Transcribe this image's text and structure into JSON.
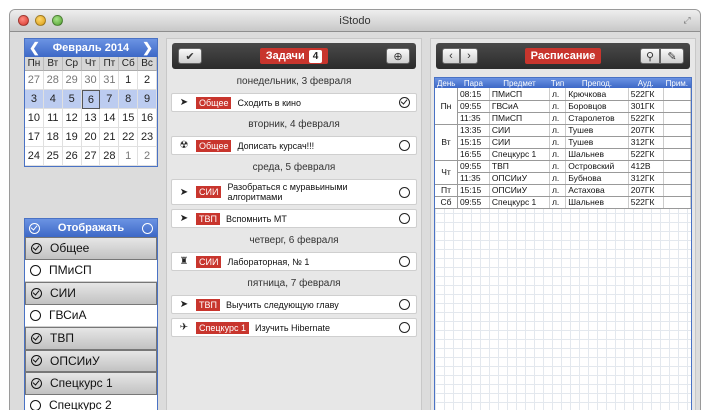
{
  "window": {
    "title": "iStodo"
  },
  "calendar": {
    "month": "Февраль 2014",
    "weekdays": [
      "Пн",
      "Вт",
      "Ср",
      "Чт",
      "Пт",
      "Сб",
      "Вс"
    ],
    "weeks": [
      [
        "27",
        "28",
        "29",
        "30",
        "31",
        "1",
        "2"
      ],
      [
        "3",
        "4",
        "5",
        "6",
        "7",
        "8",
        "9"
      ],
      [
        "10",
        "11",
        "12",
        "13",
        "14",
        "15",
        "16"
      ],
      [
        "17",
        "18",
        "19",
        "20",
        "21",
        "22",
        "23"
      ],
      [
        "24",
        "25",
        "26",
        "27",
        "28",
        "1",
        "2"
      ]
    ]
  },
  "filter": {
    "title": "Отображать",
    "items": [
      {
        "label": "Общее",
        "on": true
      },
      {
        "label": "ПМиСП",
        "on": false
      },
      {
        "label": "СИИ",
        "on": true
      },
      {
        "label": "ГВСиА",
        "on": false
      },
      {
        "label": "ТВП",
        "on": true
      },
      {
        "label": "ОПСИиУ",
        "on": true
      },
      {
        "label": "Спецкурс 1",
        "on": true
      },
      {
        "label": "Спецкурс 2",
        "on": false
      }
    ]
  },
  "tasks": {
    "title": "Задачи",
    "count": "4",
    "days": [
      {
        "date": "понедельник, 3 февраля",
        "items": [
          {
            "icon": "cursor-icon",
            "glyph": "➤",
            "tag": "Общее",
            "text": "Сходить в кино",
            "done": true
          }
        ]
      },
      {
        "date": "вторник, 4 февраля",
        "items": [
          {
            "icon": "radiation-icon",
            "glyph": "☢",
            "tag": "Общее",
            "text": "Дописать курсач!!!",
            "done": false
          }
        ]
      },
      {
        "date": "среда, 5 февраля",
        "items": [
          {
            "icon": "cursor-icon",
            "glyph": "➤",
            "tag": "СИИ",
            "text": "Разобраться с муравьиными алгоритмами",
            "done": false
          },
          {
            "icon": "cursor-icon",
            "glyph": "➤",
            "tag": "ТВП",
            "text": "Вспомнить МТ",
            "done": false
          }
        ]
      },
      {
        "date": "четверг, 6 февраля",
        "items": [
          {
            "icon": "lab-icon",
            "glyph": "♜",
            "tag": "СИИ",
            "text": "Лабораторная, № 1",
            "done": false
          }
        ]
      },
      {
        "date": "пятница, 7 февраля",
        "items": [
          {
            "icon": "cursor-icon",
            "glyph": "➤",
            "tag": "ТВП",
            "text": "Выучить следующую главу",
            "done": false
          },
          {
            "icon": "plane-icon",
            "glyph": "✈",
            "tag": "Спецкурс 1",
            "text": "Изучить Hibernate",
            "done": false
          }
        ]
      }
    ]
  },
  "schedule": {
    "title": "Расписание",
    "columns": [
      "День",
      "Пара",
      "Предмет",
      "Тип",
      "Препод.",
      "Ауд.",
      "Прим."
    ],
    "days": [
      {
        "day": "Пн",
        "rows": [
          [
            "08:15",
            "ПМиСП",
            "л.",
            "Крючкова",
            "522ГК",
            ""
          ],
          [
            "09:55",
            "ГВСиА",
            "л.",
            "Боровцов",
            "301ГК",
            ""
          ],
          [
            "11:35",
            "ПМиСП",
            "л.",
            "Старолетов",
            "522ГК",
            ""
          ]
        ]
      },
      {
        "day": "Вт",
        "rows": [
          [
            "13:35",
            "СИИ",
            "л.",
            "Тушев",
            "207ГК",
            ""
          ],
          [
            "15:15",
            "СИИ",
            "л.",
            "Тушев",
            "312ГК",
            ""
          ],
          [
            "16:55",
            "Спецкурс 1",
            "л.",
            "Шальнев",
            "522ГК",
            ""
          ]
        ]
      },
      {
        "day": "Чт",
        "rows": [
          [
            "09:55",
            "ТВП",
            "л.",
            "Островский",
            "412В",
            ""
          ],
          [
            "11:35",
            "ОПСИиУ",
            "л.",
            "Бубнова",
            "312ГК",
            ""
          ]
        ]
      },
      {
        "day": "Пт",
        "rows": [
          [
            "15:15",
            "ОПСИиУ",
            "л.",
            "Астахова",
            "207ГК",
            ""
          ]
        ]
      },
      {
        "day": "Сб",
        "rows": [
          [
            "09:55",
            "Спецкурс 1",
            "л.",
            "Шальнев",
            "522ГК",
            ""
          ]
        ]
      }
    ]
  },
  "colors": {
    "accent_blue": "#3d68c6",
    "tag_red": "#c8352d",
    "week_highlight": "#bcccf0"
  }
}
